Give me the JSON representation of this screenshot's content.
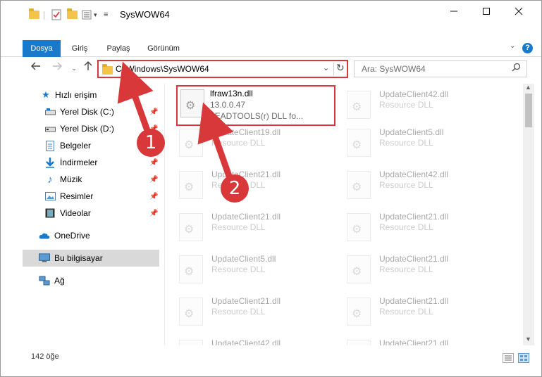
{
  "window": {
    "title": "SysWOW64"
  },
  "ribbon": {
    "tabs": [
      {
        "label": "Dosya"
      },
      {
        "label": "Giriş"
      },
      {
        "label": "Paylaş"
      },
      {
        "label": "Görünüm"
      }
    ],
    "help_label": "?"
  },
  "address": {
    "path": "C:\\Windows\\SysWOW64"
  },
  "search": {
    "placeholder": "Ara: SysWOW64"
  },
  "nav": {
    "quick_access": "Hızlı erişim",
    "items": [
      {
        "label": "Yerel Disk (C:)"
      },
      {
        "label": "Yerel Disk (D:)"
      },
      {
        "label": "Belgeler"
      },
      {
        "label": "İndirmeler"
      },
      {
        "label": "Müzik"
      },
      {
        "label": "Resimler"
      },
      {
        "label": "Videolar"
      }
    ],
    "onedrive": "OneDrive",
    "this_pc": "Bu bilgisayar",
    "network": "Ağ"
  },
  "files": {
    "highlighted": {
      "name": "lfraw13n.dll",
      "version": "13.0.0.47",
      "description": "LEADTOOLS(r) DLL fo..."
    },
    "left": [
      {
        "name": "UpdateClient19.dll",
        "type": "Resource DLL"
      },
      {
        "name": "UpdateClient21.dll",
        "type": "Resource DLL"
      },
      {
        "name": "UpdateClient21.dll",
        "type": "Resource DLL"
      },
      {
        "name": "UpdateClient5.dll",
        "type": "Resource DLL"
      },
      {
        "name": "UpdateClient21.dll",
        "type": "Resource DLL"
      },
      {
        "name": "UpdateClient42.dll",
        "type": "Resource DLL"
      }
    ],
    "right": [
      {
        "name": "UpdateClient42.dll",
        "type": "Resource DLL"
      },
      {
        "name": "UpdateClient5.dll",
        "type": "Resource DLL"
      },
      {
        "name": "UpdateClient42.dll",
        "type": "Resource DLL"
      },
      {
        "name": "UpdateClient21.dll",
        "type": "Resource DLL"
      },
      {
        "name": "UpdateClient21.dll",
        "type": "Resource DLL"
      },
      {
        "name": "UpdateClient21.dll",
        "type": "Resource DLL"
      },
      {
        "name": "UpdateClient21.dll",
        "type": "Resource DLL"
      }
    ]
  },
  "status": {
    "count": "142 öğe"
  },
  "annotations": {
    "badge1": "1",
    "badge2": "2",
    "color": "#d9383a"
  }
}
